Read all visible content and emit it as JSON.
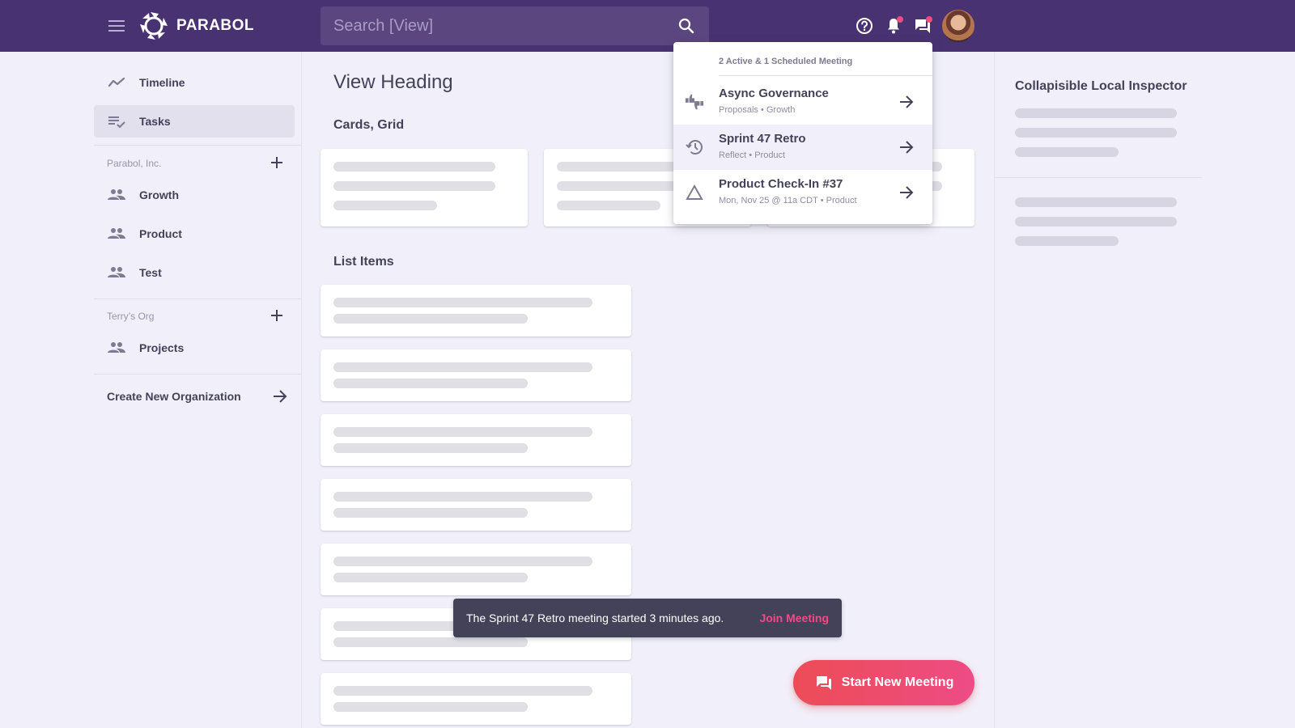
{
  "topbar": {
    "brand": "PARABOL",
    "search_placeholder": "Search [View]",
    "search_value": "",
    "icons": {
      "menu": "hamburger-icon",
      "logo": "parabol-logo-icon",
      "search": "search-icon",
      "help": "help-circle-icon",
      "notifications": "bell-icon",
      "meetings": "forum-icon",
      "avatar": "user-avatar"
    },
    "notifications_has_badge": true,
    "meetings_has_badge": true,
    "badge_color": "#ED4C86",
    "background_color": "#493272"
  },
  "sidebar": {
    "items": [
      {
        "label": "Timeline",
        "icon": "timeline-icon",
        "active": false
      },
      {
        "label": "Tasks",
        "icon": "tasks-icon",
        "active": true
      }
    ],
    "orgs": [
      {
        "name": "Parabol, Inc.",
        "add_icon": "plus-icon",
        "teams": [
          {
            "label": "Growth",
            "icon": "group-icon"
          },
          {
            "label": "Product",
            "icon": "group-icon"
          },
          {
            "label": "Test",
            "icon": "group-icon"
          }
        ]
      },
      {
        "name": "Terry’s Org",
        "add_icon": "plus-icon",
        "teams": [
          {
            "label": "Projects",
            "icon": "group-icon"
          }
        ]
      }
    ],
    "create_org_label": "Create New Organization",
    "create_org_icon": "arrow-right-icon"
  },
  "main": {
    "heading": "View Heading",
    "cards_section_title": "Cards, Grid",
    "cards_count": 3,
    "list_section_title": "List Items",
    "list_items_count": 7
  },
  "inspector": {
    "title": "Collapisible Local Inspector"
  },
  "meetings_dropdown": {
    "header": "2 Active & 1 Scheduled Meeting",
    "items": [
      {
        "title": "Async Governance",
        "subtitle": "Proposals • Growth",
        "icon": "thumbs-up-down-icon",
        "hovered": false
      },
      {
        "title": "Sprint 47 Retro",
        "subtitle": "Reflect • Product",
        "icon": "history-icon",
        "hovered": true
      },
      {
        "title": "Product Check-In #37",
        "subtitle": "Mon, Nov 25 @ 11a CDT • Product",
        "icon": "triangle-icon",
        "hovered": false
      }
    ],
    "arrow_icon": "arrow-right-icon"
  },
  "snackbar": {
    "message": "The Sprint 47 Retro meeting started 3 minutes ago.",
    "action": "Join Meeting",
    "action_color": "#ED4C86"
  },
  "fab": {
    "label": "Start New Meeting",
    "icon": "forum-icon",
    "gradient": [
      "#ED4C56",
      "#ED4C86"
    ]
  }
}
